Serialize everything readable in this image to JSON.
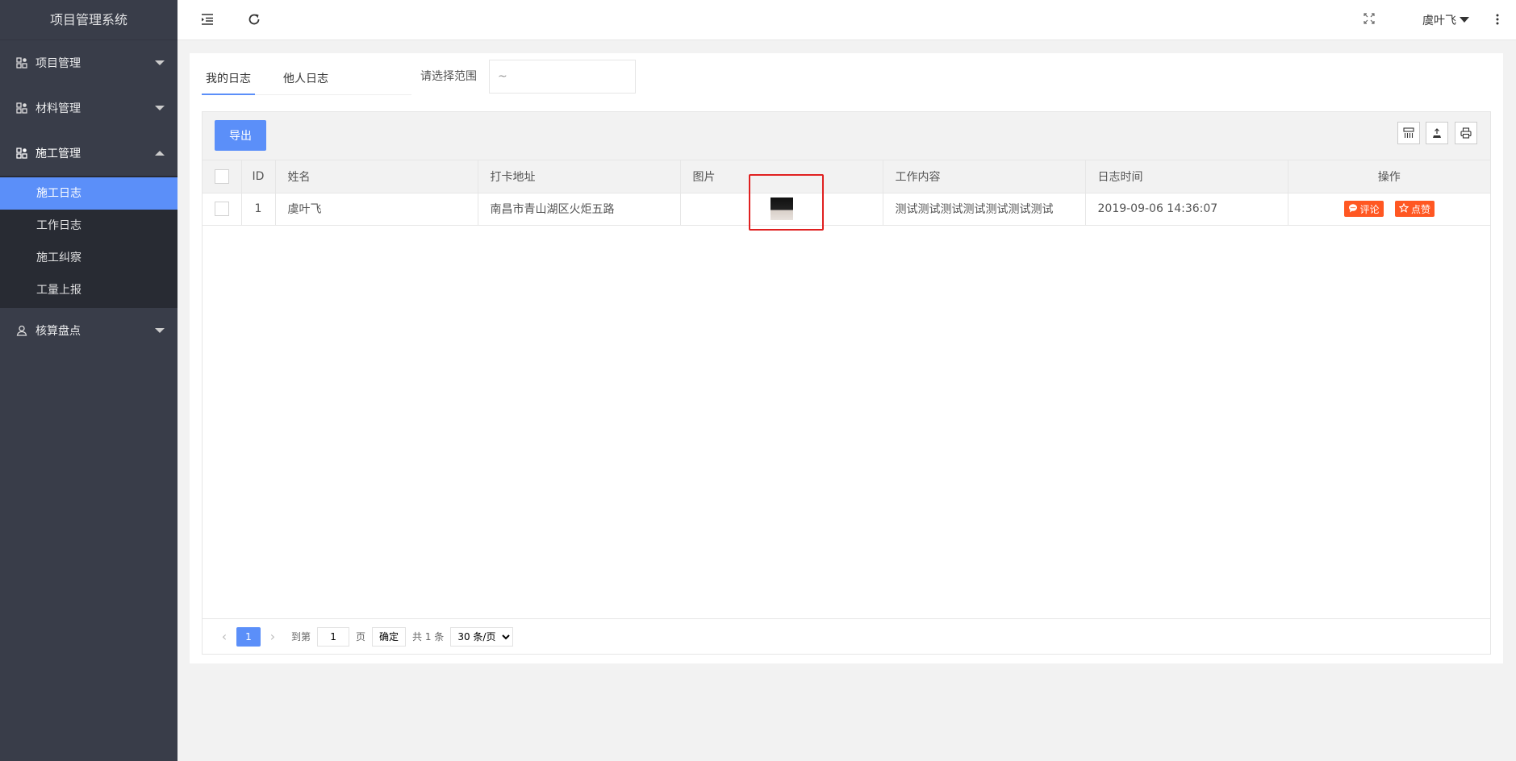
{
  "app": {
    "title": "项目管理系统"
  },
  "sidebar": {
    "items": [
      {
        "label": "项目管理",
        "expanded": false
      },
      {
        "label": "材料管理",
        "expanded": false
      },
      {
        "label": "施工管理",
        "expanded": true,
        "children": [
          {
            "label": "施工日志",
            "active": true
          },
          {
            "label": "工作日志"
          },
          {
            "label": "施工纠察"
          },
          {
            "label": "工量上报"
          }
        ]
      },
      {
        "label": "核算盘点",
        "expanded": false
      }
    ]
  },
  "header": {
    "user": "虞叶飞"
  },
  "tabs": [
    {
      "label": "我的日志",
      "active": true
    },
    {
      "label": "他人日志"
    }
  ],
  "filter": {
    "label": "请选择范围",
    "value": "~"
  },
  "toolbar": {
    "export_label": "导出"
  },
  "table": {
    "columns": [
      "ID",
      "姓名",
      "打卡地址",
      "图片",
      "工作内容",
      "日志时间",
      "操作"
    ],
    "rows": [
      {
        "id": "1",
        "name": "虞叶飞",
        "address": "南昌市青山湖区火炬五路",
        "content": "测试测试测试测试测试测试测试",
        "time": "2019-09-06 14:36:07",
        "actions": {
          "comment": "评论",
          "like": "点赞"
        }
      }
    ]
  },
  "pager": {
    "current": "1",
    "goto_label": "到第",
    "page_input": "1",
    "page_unit": "页",
    "confirm": "确定",
    "total": "共 1 条",
    "page_size": "30 条/页"
  },
  "colors": {
    "sidebar": "#393d49",
    "primary": "#5b8ff9",
    "danger": "#ff5722",
    "highlight": "#e02020"
  }
}
